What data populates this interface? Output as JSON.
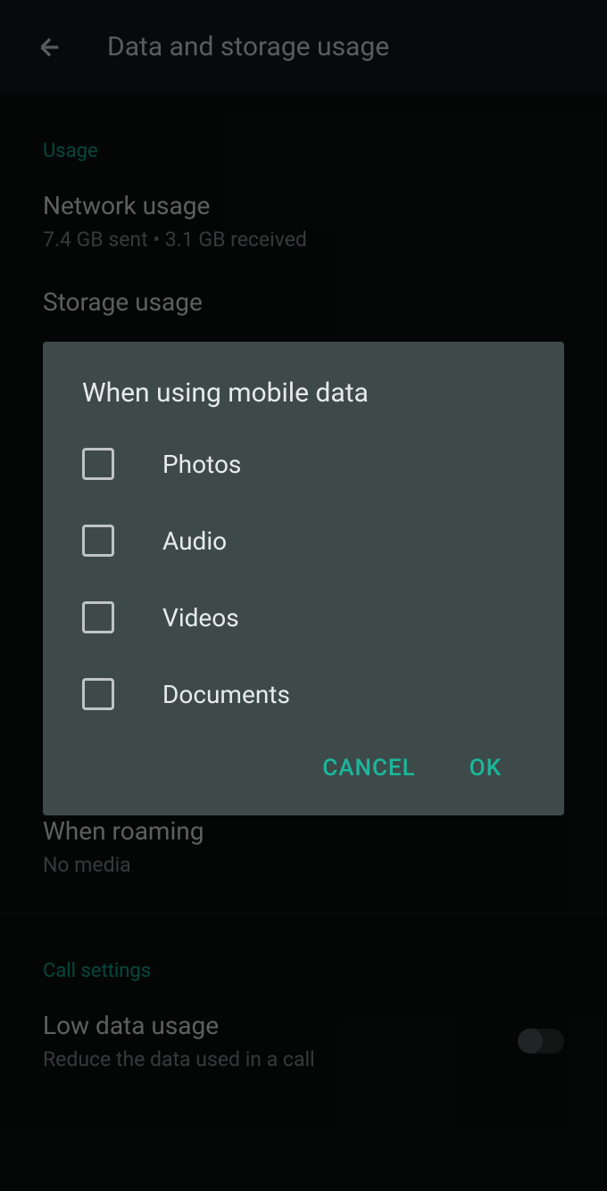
{
  "header": {
    "title": "Data and storage usage"
  },
  "sections": {
    "usage": {
      "header": "Usage",
      "network": {
        "title": "Network usage",
        "subtitle": "7.4 GB sent • 3.1 GB received"
      },
      "storage": {
        "title": "Storage usage"
      }
    },
    "roaming": {
      "title": "When roaming",
      "subtitle": "No media"
    },
    "call": {
      "header": "Call settings",
      "lowData": {
        "title": "Low data usage",
        "subtitle": "Reduce the data used in a call"
      }
    }
  },
  "dialog": {
    "title": "When using mobile data",
    "options": {
      "photos": "Photos",
      "audio": "Audio",
      "videos": "Videos",
      "documents": "Documents"
    },
    "buttons": {
      "cancel": "CANCEL",
      "ok": "OK"
    }
  }
}
